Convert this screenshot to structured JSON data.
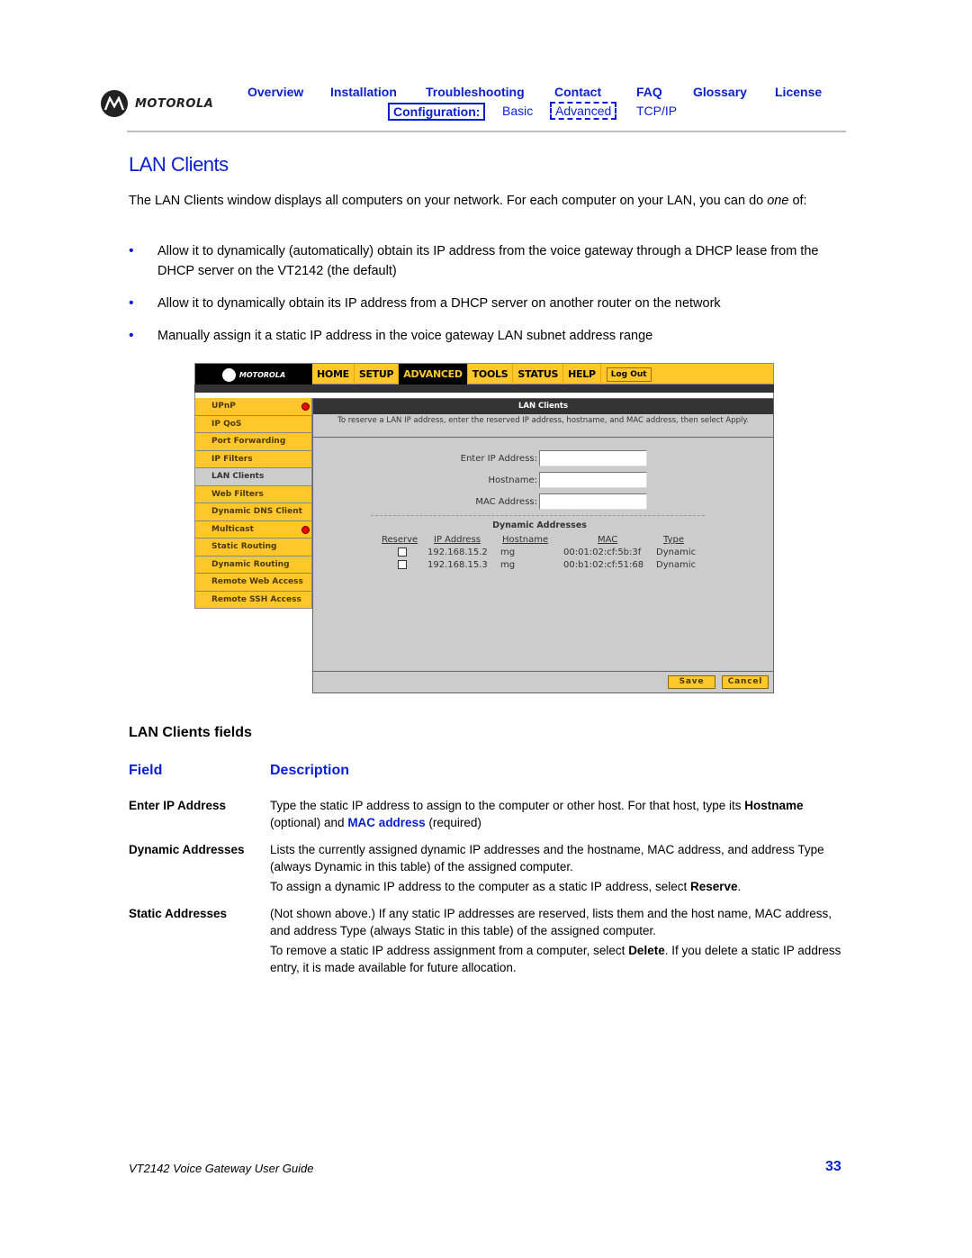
{
  "header": {
    "brand": "MOTOROLA",
    "nav": [
      "Overview",
      "Installation",
      "Troubleshooting",
      "Contact",
      "FAQ",
      "Glossary",
      "License"
    ],
    "subnav": {
      "label": "Configuration:",
      "items": [
        "Basic",
        "Advanced",
        "TCP/IP"
      ],
      "current": "Advanced"
    }
  },
  "title": "LAN Clients",
  "intro": {
    "text": "The LAN Clients window displays all computers on your network. For each computer on your LAN, you can do ",
    "emph": "one",
    "tail": " of:"
  },
  "bullets": [
    "Allow it to dynamically (automatically) obtain its IP address from the voice gateway through a DHCP lease from the DHCP server on the VT2142 (the default)",
    "Allow it to dynamically obtain its IP address from a DHCP server on another router on the network",
    "Manually assign it a static IP address in the voice gateway LAN subnet address range"
  ],
  "screenshot": {
    "brand": "MOTOROLA",
    "tabs": [
      "HOME",
      "SETUP",
      "ADVANCED",
      "TOOLS",
      "STATUS",
      "HELP"
    ],
    "active_tab": "ADVANCED",
    "logout": "Log Out",
    "sidebar": [
      {
        "label": "UPnP",
        "alert": true
      },
      {
        "label": "IP QoS",
        "alert": false
      },
      {
        "label": "Port Forwarding",
        "alert": false
      },
      {
        "label": "IP Filters",
        "alert": false
      },
      {
        "label": "LAN Clients",
        "alert": false,
        "selected": true
      },
      {
        "label": "Web Filters",
        "alert": false
      },
      {
        "label": "Dynamic DNS Client",
        "alert": false
      },
      {
        "label": "Multicast",
        "alert": true
      },
      {
        "label": "Static Routing",
        "alert": false
      },
      {
        "label": "Dynamic Routing",
        "alert": false
      },
      {
        "label": "Remote Web Access",
        "alert": false
      },
      {
        "label": "Remote SSH Access",
        "alert": false
      }
    ],
    "panel_title": "LAN Clients",
    "panel_note": "To reserve a LAN IP address, enter the reserved IP address, hostname, and MAC address, then select Apply.",
    "form": {
      "ip_label": "Enter IP Address:",
      "ip_value": "",
      "host_label": "Hostname:",
      "host_value": "",
      "mac_label": "MAC Address:",
      "mac_value": ""
    },
    "dynamic": {
      "title": "Dynamic Addresses",
      "columns": [
        "Reserve",
        "IP Address",
        "Hostname",
        "MAC",
        "Type"
      ],
      "rows": [
        {
          "reserve": false,
          "ip": "192.168.15.2",
          "host": "mg",
          "mac": "00:01:02:cf:5b:3f",
          "type": "Dynamic"
        },
        {
          "reserve": false,
          "ip": "192.168.15.3",
          "host": "mg",
          "mac": "00:b1:02:cf:51:68",
          "type": "Dynamic"
        }
      ]
    },
    "save": "Save",
    "cancel": "Cancel"
  },
  "fields_section": {
    "heading": "LAN Clients fields",
    "col_field": "Field",
    "col_desc": "Description",
    "rows": [
      {
        "name": "Enter IP Address",
        "desc1_a": "Type the static IP address to assign to the computer or other host. For that host, type its ",
        "desc1_b": "Hostname",
        "desc1_c": " (optional) and ",
        "desc1_d": "MAC address",
        "desc1_e": " (required)"
      },
      {
        "name": "Dynamic Addresses",
        "desc1": "Lists the currently assigned dynamic IP addresses and the hostname, MAC address, and address Type (always Dynamic in this table) of the assigned computer.",
        "desc2_a": "To assign a dynamic IP address to the computer as a static IP address, select ",
        "desc2_b": "Reserve",
        "desc2_c": "."
      },
      {
        "name": "Static Addresses",
        "desc1": "(Not shown above.) If any static IP addresses are reserved, lists them and the host name, MAC address, and address Type (always Static in this table) of the assigned computer.",
        "desc2_a": "To remove a static IP address assignment from a computer, select ",
        "desc2_b": "Delete",
        "desc2_c": ". If you delete a static IP address entry, it is made available for future allocation."
      }
    ]
  },
  "footer": {
    "title": "VT2142 Voice Gateway User Guide",
    "page": "33"
  }
}
